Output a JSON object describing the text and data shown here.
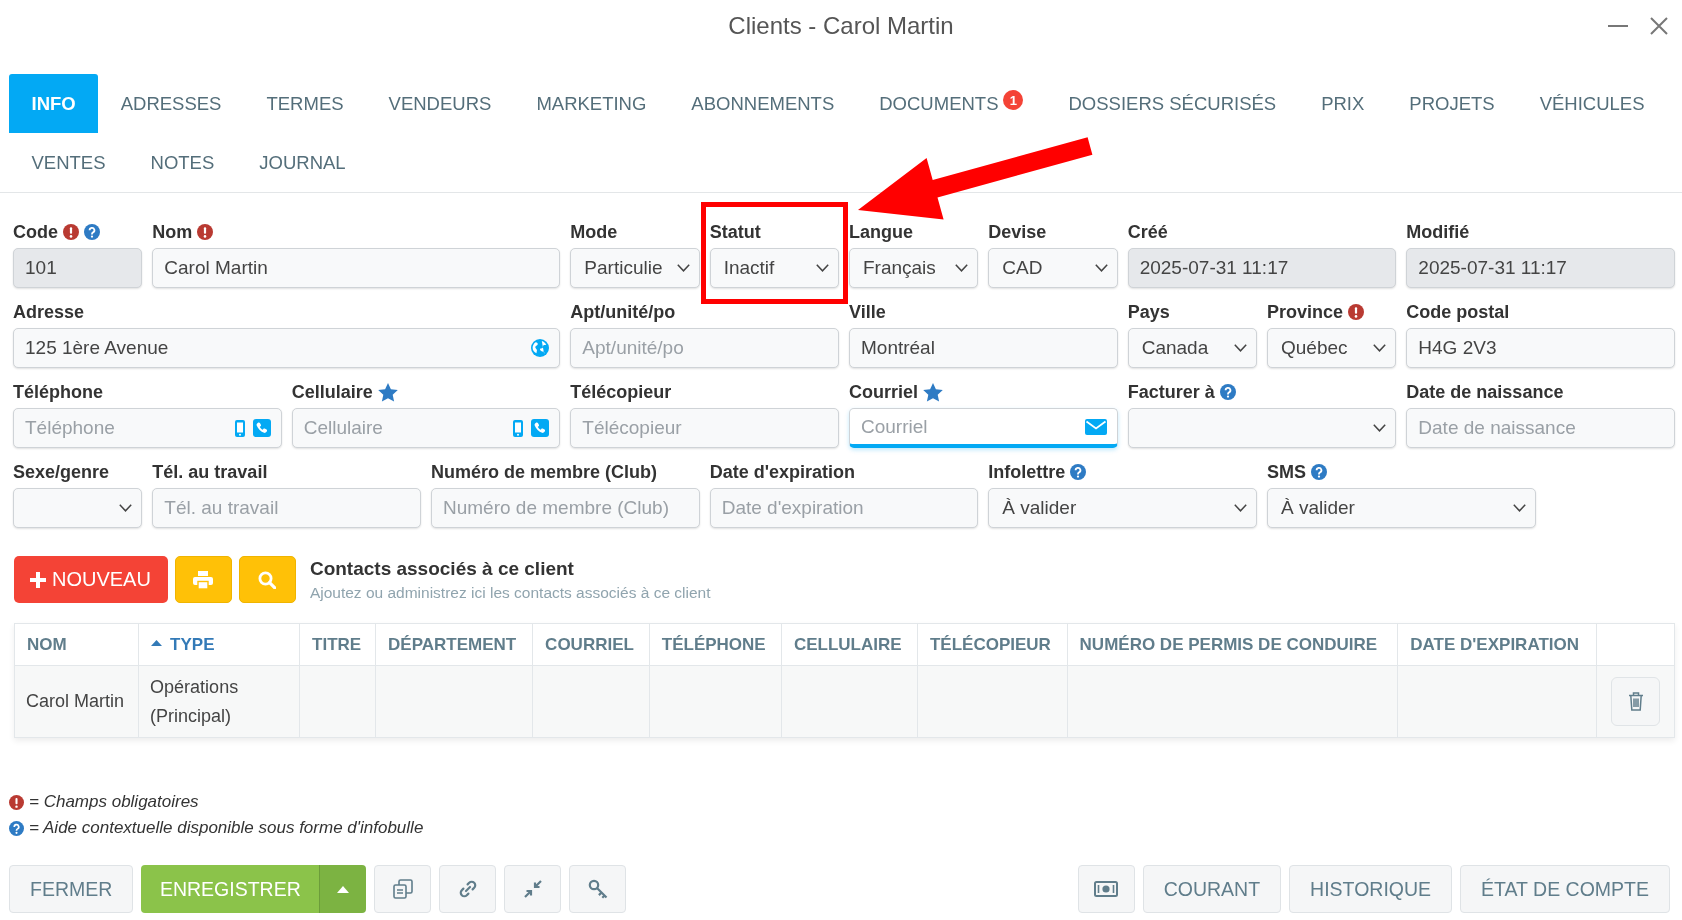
{
  "window": {
    "title": "Clients - Carol Martin"
  },
  "tabs": [
    {
      "label": "INFO",
      "selected": true
    },
    {
      "label": "ADRESSES",
      "selected": false
    },
    {
      "label": "TERMES",
      "selected": false
    },
    {
      "label": "VENDEURS",
      "selected": false
    },
    {
      "label": "MARKETING",
      "selected": false
    },
    {
      "label": "ABONNEMENTS",
      "selected": false
    },
    {
      "label": "DOCUMENTS",
      "selected": false,
      "badge": "1"
    },
    {
      "label": "DOSSIERS SÉCURISÉS",
      "selected": false
    },
    {
      "label": "PRIX",
      "selected": false
    },
    {
      "label": "PROJETS",
      "selected": false
    },
    {
      "label": "VÉHICULES",
      "selected": false
    },
    {
      "label": "VENTES",
      "selected": false
    },
    {
      "label": "NOTES",
      "selected": false
    },
    {
      "label": "JOURNAL",
      "selected": false
    }
  ],
  "form": {
    "rows": [
      {
        "fields": [
          {
            "label": "Code",
            "kind": "text",
            "value": "101",
            "required": true,
            "help": true,
            "starred": false,
            "disabled": true,
            "focused": false,
            "highlighted": false
          },
          {
            "label": "Nom",
            "kind": "text",
            "value": "Carol Martin",
            "required": true,
            "help": false,
            "starred": false,
            "disabled": false,
            "focused": false,
            "highlighted": false
          },
          {
            "label": "Mode",
            "kind": "select",
            "value": "Particulie",
            "required": false,
            "help": false,
            "starred": false,
            "disabled": false,
            "focused": false,
            "highlighted": false
          },
          {
            "label": "Statut",
            "kind": "select",
            "value": "Inactif",
            "required": false,
            "help": false,
            "starred": false,
            "disabled": false,
            "focused": false,
            "highlighted": true
          },
          {
            "label": "Langue",
            "kind": "select",
            "value": "Français",
            "required": false,
            "help": false,
            "starred": false,
            "disabled": false,
            "focused": false,
            "highlighted": false
          },
          {
            "label": "Devise",
            "kind": "select",
            "value": "CAD",
            "required": false,
            "help": false,
            "starred": false,
            "disabled": false,
            "focused": false,
            "highlighted": false
          },
          {
            "label": "Créé",
            "kind": "text",
            "value": "2025-07-31 11:17",
            "required": false,
            "help": false,
            "starred": false,
            "disabled": true,
            "focused": false,
            "highlighted": false
          },
          {
            "label": "Modifié",
            "kind": "text",
            "value": "2025-07-31 11:17",
            "required": false,
            "help": false,
            "starred": false,
            "disabled": true,
            "focused": false,
            "highlighted": false
          }
        ]
      },
      {
        "fields": [
          {
            "label": "Adresse",
            "kind": "address",
            "value": "125 1ère Avenue",
            "required": false,
            "help": false,
            "starred": false,
            "disabled": false,
            "focused": false,
            "highlighted": false
          },
          {
            "label": "Apt/unité/po",
            "kind": "text",
            "placeholder": "Apt/unité/po",
            "required": false,
            "help": false,
            "starred": false,
            "disabled": false,
            "focused": false,
            "highlighted": false
          },
          {
            "label": "Ville",
            "kind": "text",
            "value": "Montréal",
            "required": false,
            "help": false,
            "starred": false,
            "disabled": false,
            "focused": false,
            "highlighted": false
          },
          {
            "label": "Pays",
            "kind": "select",
            "value": "Canada",
            "required": false,
            "help": false,
            "starred": false,
            "disabled": false,
            "focused": false,
            "highlighted": false
          },
          {
            "label": "Province",
            "kind": "select",
            "value": "Québec",
            "required": true,
            "help": false,
            "starred": false,
            "disabled": false,
            "focused": false,
            "highlighted": false
          },
          {
            "label": "Code postal",
            "kind": "text",
            "value": "H4G 2V3",
            "required": false,
            "help": false,
            "starred": false,
            "disabled": false,
            "focused": false,
            "highlighted": false
          }
        ]
      },
      {
        "fields": [
          {
            "label": "Téléphone",
            "kind": "phone",
            "placeholder": "Téléphone",
            "required": false,
            "help": false,
            "starred": false,
            "disabled": false,
            "focused": false,
            "highlighted": false
          },
          {
            "label": "Cellulaire",
            "kind": "phone",
            "placeholder": "Cellulaire",
            "required": false,
            "help": false,
            "starred": true,
            "disabled": false,
            "focused": false,
            "highlighted": false
          },
          {
            "label": "Télécopieur",
            "kind": "text",
            "placeholder": "Télécopieur",
            "required": false,
            "help": false,
            "starred": false,
            "disabled": false,
            "focused": false,
            "highlighted": false
          },
          {
            "label": "Courriel",
            "kind": "email",
            "placeholder": "Courriel",
            "required": false,
            "help": false,
            "starred": true,
            "disabled": false,
            "focused": true,
            "highlighted": false
          },
          {
            "label": "Facturer à",
            "kind": "select",
            "required": false,
            "help": true,
            "starred": false,
            "disabled": false,
            "focused": false,
            "highlighted": false
          },
          {
            "label": "Date de naissance",
            "kind": "text",
            "placeholder": "Date de naissance",
            "required": false,
            "help": false,
            "starred": false,
            "disabled": false,
            "focused": false,
            "highlighted": false
          }
        ]
      },
      {
        "fields": [
          {
            "label": "Sexe/genre",
            "kind": "select",
            "required": false,
            "help": false,
            "starred": false,
            "disabled": false,
            "focused": false,
            "highlighted": false
          },
          {
            "label": "Tél. au travail",
            "kind": "text",
            "placeholder": "Tél. au travail",
            "required": false,
            "help": false,
            "starred": false,
            "disabled": false,
            "focused": false,
            "highlighted": false
          },
          {
            "label": "Numéro de membre (Club)",
            "kind": "text",
            "placeholder": "Numéro de membre (Club)",
            "required": false,
            "help": false,
            "starred": false,
            "disabled": false,
            "focused": false,
            "highlighted": false
          },
          {
            "label": "Date d'expiration",
            "kind": "text",
            "placeholder": "Date d'expiration",
            "required": false,
            "help": false,
            "starred": false,
            "disabled": false,
            "focused": false,
            "highlighted": false
          },
          {
            "label": "Infolettre",
            "kind": "select",
            "value": "À valider",
            "required": false,
            "help": true,
            "starred": false,
            "disabled": false,
            "focused": false,
            "highlighted": false
          },
          {
            "label": "SMS",
            "kind": "select",
            "value": "À valider",
            "required": false,
            "help": true,
            "starred": false,
            "disabled": false,
            "focused": false,
            "highlighted": false
          }
        ]
      }
    ]
  },
  "contacts": {
    "buttons": [
      {
        "kind": "add",
        "label": "NOUVEAU"
      },
      {
        "kind": "print"
      },
      {
        "kind": "search"
      }
    ],
    "title": "Contacts associés à ce client",
    "subtitle": "Ajoutez ou administrez ici les contacts associés à ce client",
    "table": {
      "columns": [
        {
          "label": "NOM",
          "sorted": false
        },
        {
          "label": "TYPE",
          "sorted": true
        },
        {
          "label": "TITRE",
          "sorted": false
        },
        {
          "label": "DÉPARTEMENT",
          "sorted": false
        },
        {
          "label": "COURRIEL",
          "sorted": false
        },
        {
          "label": "TÉLÉPHONE",
          "sorted": false
        },
        {
          "label": "CELLULAIRE",
          "sorted": false
        },
        {
          "label": "TÉLÉCOPIEUR",
          "sorted": false
        },
        {
          "label": "NUMÉRO DE PERMIS DE CONDUIRE",
          "sorted": false
        },
        {
          "label": "DATE D'EXPIRATION",
          "sorted": false
        }
      ],
      "rows": [
        {
          "cells": [
            "Carol Martin",
            "Opérations (Principal)"
          ]
        }
      ]
    }
  },
  "legend": [
    {
      "kind": "required",
      "text": "= Champs obligatoires"
    },
    {
      "kind": "help",
      "text": "= Aide contextuelle disponible sous forme d'infobulle"
    }
  ],
  "footer": {
    "left": [
      {
        "kind": "text",
        "label": "FERMER"
      },
      {
        "kind": "split",
        "label": "ENREGISTRER"
      },
      {
        "kind": "copy"
      },
      {
        "kind": "link"
      },
      {
        "kind": "compress"
      },
      {
        "kind": "key"
      }
    ],
    "right": [
      {
        "kind": "money"
      },
      {
        "kind": "text",
        "label": "COURANT"
      },
      {
        "kind": "text",
        "label": "HISTORIQUE"
      },
      {
        "kind": "text",
        "label": "ÉTAT DE COMPTE"
      }
    ]
  }
}
